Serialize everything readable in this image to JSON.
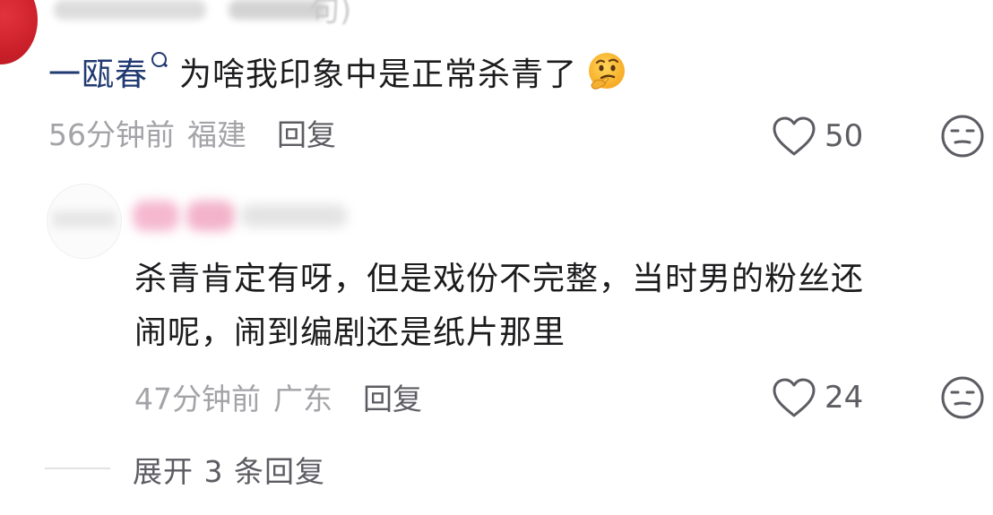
{
  "top_partial": {
    "paren_glyph": "句)"
  },
  "comment_1": {
    "username": "一瓯春",
    "text": "为啥我印象中是正常杀青了",
    "emoji": "thinking-face",
    "time": "56分钟前",
    "location": "福建",
    "reply_label": "回复",
    "like_count": "50"
  },
  "reply_1": {
    "text_line1": "杀青肯定有呀，但是戏份不完整，当时男的粉丝还",
    "text_line2": "闹呢，闹到编剧还是纸片那里",
    "time": "47分钟前",
    "location": "广东",
    "reply_label": "回复",
    "like_count": "24"
  },
  "expand": {
    "label": "展开 3 条回复"
  },
  "colors": {
    "username": "#213a72",
    "meta_gray": "#a3a3a8",
    "action_gray": "#5c5c62",
    "avatar_red": "#c91f29"
  },
  "icons": [
    "heart-outline-icon",
    "dislike-face-icon",
    "author-search-badge-icon",
    "thinking-face-emoji"
  ]
}
